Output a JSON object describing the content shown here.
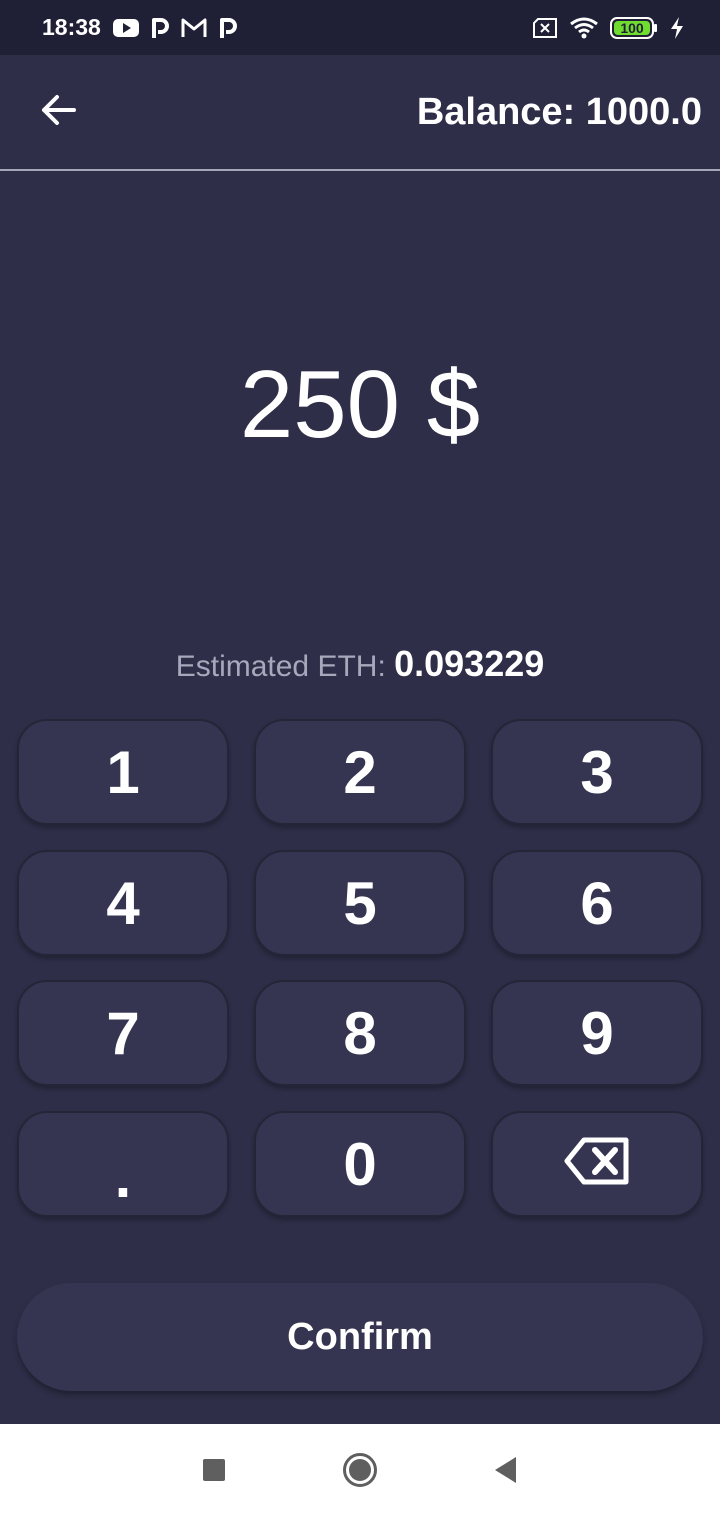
{
  "status_bar": {
    "time": "18:38",
    "battery": "100",
    "icons": [
      "youtube-icon",
      "p-app-icon",
      "gmail-icon",
      "p-app-icon",
      "no-sim-icon",
      "wifi-icon",
      "battery-icon",
      "charging-icon"
    ]
  },
  "header": {
    "back_icon": "arrow-left-icon",
    "balance": "Balance: 1000.0"
  },
  "amount": {
    "display": "250 $"
  },
  "estimate": {
    "label": "Estimated ETH:",
    "value": "0.093229"
  },
  "keypad": {
    "keys": [
      "1",
      "2",
      "3",
      "4",
      "5",
      "6",
      "7",
      "8",
      "9",
      ".",
      "0"
    ],
    "backspace_icon": "backspace-icon"
  },
  "confirm_label": "Confirm",
  "nav": {
    "icons": [
      "recents-square-icon",
      "home-circle-icon",
      "back-triangle-icon"
    ]
  },
  "colors": {
    "background": "#2e2e48",
    "status_bar": "#1f1f35",
    "key": "#353552",
    "battery_green": "#6fdc2f"
  }
}
